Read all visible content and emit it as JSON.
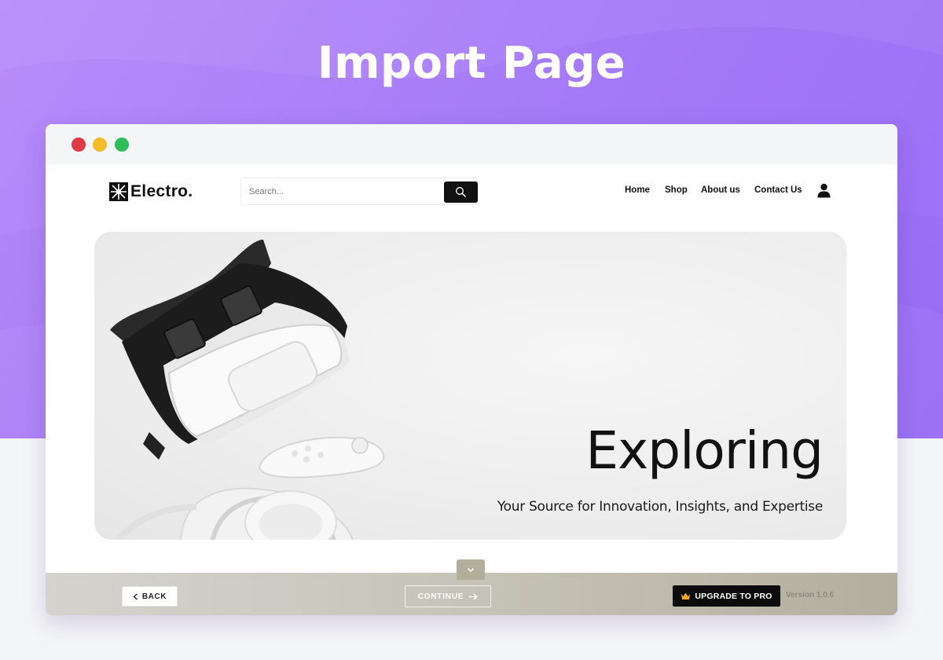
{
  "page": {
    "heading": "Import Page"
  },
  "colors": {
    "purple": "#a77cf8",
    "dot_red": "#e03a47",
    "dot_yellow": "#f6bb2a",
    "dot_green": "#2ebe55",
    "upgrade_bg": "#0c0c0c",
    "footer_bg": "#c6c3b8"
  },
  "browser": {
    "window_controls": [
      "close",
      "minimize",
      "maximize"
    ]
  },
  "site": {
    "logo_text": "Electro.",
    "logo_icon": "starburst-icon",
    "search": {
      "placeholder": "Search...",
      "value": "",
      "button_icon": "search-icon"
    },
    "nav": [
      "Home",
      "Shop",
      "About us",
      "Contact Us"
    ],
    "account_icon": "user-icon"
  },
  "hero": {
    "title": "Exploring",
    "subtitle": "Your Source for Innovation, Insights, and Expertise",
    "image": "vr-headset-controller-headphones"
  },
  "footer": {
    "scroll_icon": "chevron-down-icon",
    "back_label": "BACK",
    "back_icon": "chevron-left-icon",
    "continue_label": "CONTINUE",
    "continue_icon": "arrow-right-icon",
    "upgrade_label": "UPGRADE TO PRO",
    "upgrade_icon": "crown-icon",
    "version": "Version 1.0.6"
  }
}
